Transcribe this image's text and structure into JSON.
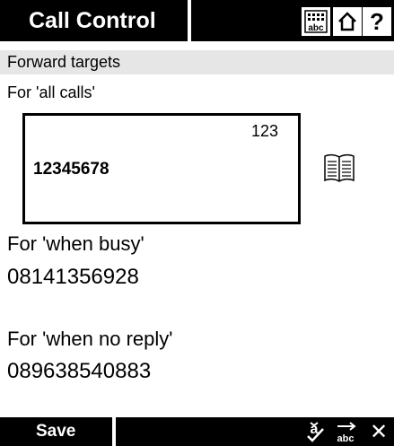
{
  "topbar": {
    "title": "Call Control",
    "icons": [
      "keyboard-abc-icon",
      "home-icon",
      "help-icon"
    ],
    "help_glyph": "?"
  },
  "section": {
    "header": "Forward targets",
    "sublabel": "For 'all calls'"
  },
  "all_calls": {
    "mode_indicator": "123",
    "value": "12345678"
  },
  "when_busy": {
    "label": "For 'when busy'",
    "value": "08141356928"
  },
  "when_no_reply": {
    "label": "For 'when no reply'",
    "value": "089638540883"
  },
  "bottombar": {
    "save_label": "Save",
    "icons": [
      "spellcheck-icon",
      "abc-arrow-icon",
      "close-icon"
    ],
    "close_glyph": "✕"
  }
}
